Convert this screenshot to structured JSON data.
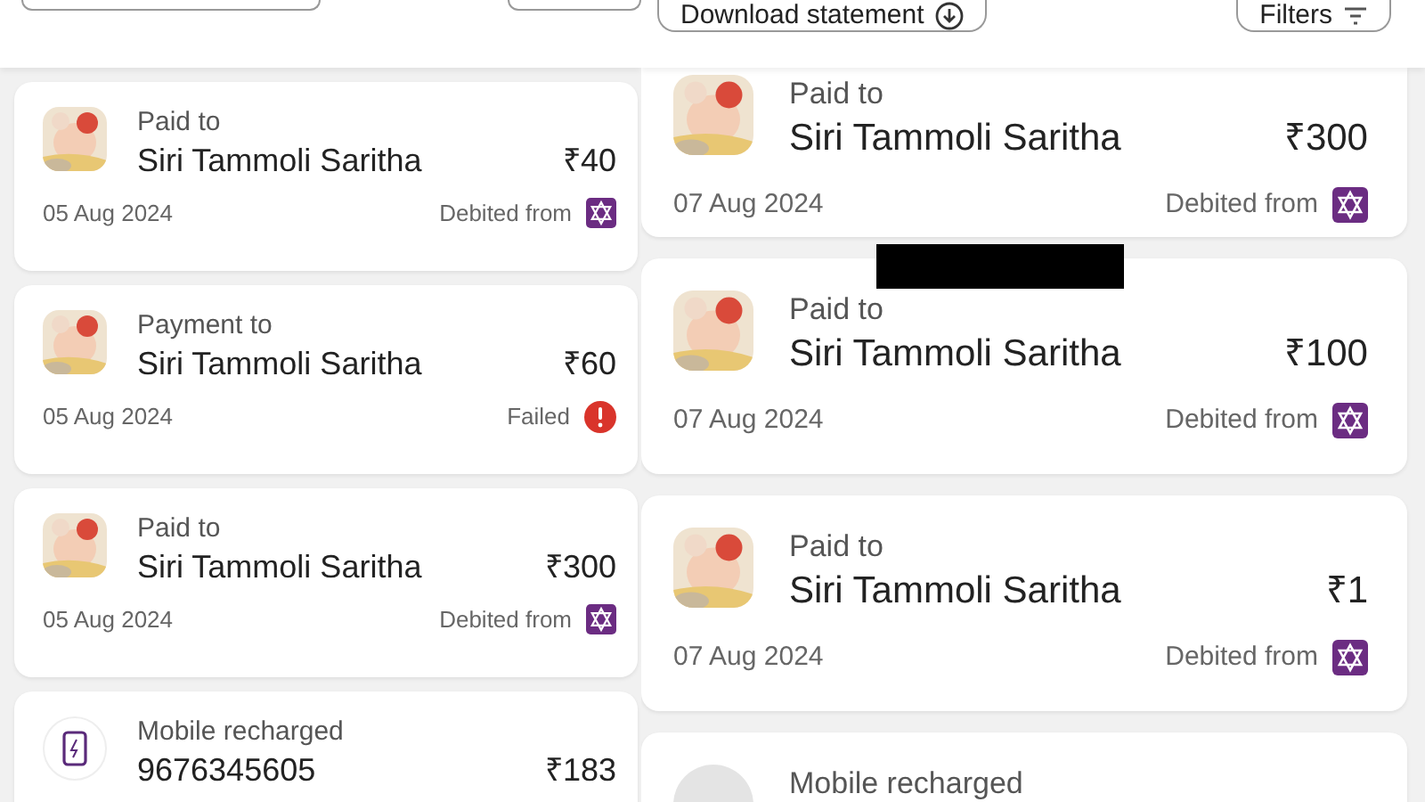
{
  "panels": [
    {
      "transactions": [
        {
          "kind": "payment",
          "label": "Paid to",
          "name": "Siri Tammoli Saritha",
          "amount": "₹40",
          "date": "05 Aug 2024",
          "failed": false,
          "status_text": "Debited from"
        },
        {
          "kind": "payment",
          "label": "Payment to",
          "name": "Siri Tammoli Saritha",
          "amount": "₹60",
          "date": "05 Aug 2024",
          "failed": true,
          "status_text": "Failed"
        },
        {
          "kind": "payment",
          "label": "Paid to",
          "name": "Siri Tammoli Saritha",
          "amount": "₹300",
          "date": "05 Aug 2024",
          "failed": false,
          "status_text": "Debited from"
        },
        {
          "kind": "recharge",
          "label": "Mobile recharged",
          "name": "9676345605",
          "amount": "₹183"
        }
      ]
    },
    {
      "header_buttons": [
        {
          "label": "Download statement"
        },
        {
          "label": "Filters"
        }
      ],
      "transactions": [
        {
          "kind": "payment",
          "label": "Paid to",
          "name": "Siri Tammoli Saritha",
          "amount": "₹300",
          "date": "07 Aug 2024",
          "failed": false,
          "status_text": "Debited from"
        },
        {
          "kind": "payment",
          "label": "Paid to",
          "name": "Siri Tammoli Saritha",
          "amount": "₹100",
          "date": "07 Aug 2024",
          "failed": false,
          "status_text": "Debited from"
        },
        {
          "kind": "payment",
          "label": "Paid to",
          "name": "Siri Tammoli Saritha",
          "amount": "₹1",
          "date": "07 Aug 2024",
          "failed": false,
          "status_text": "Debited from"
        },
        {
          "kind": "recharge_pending",
          "label": "Mobile recharged"
        }
      ]
    }
  ]
}
